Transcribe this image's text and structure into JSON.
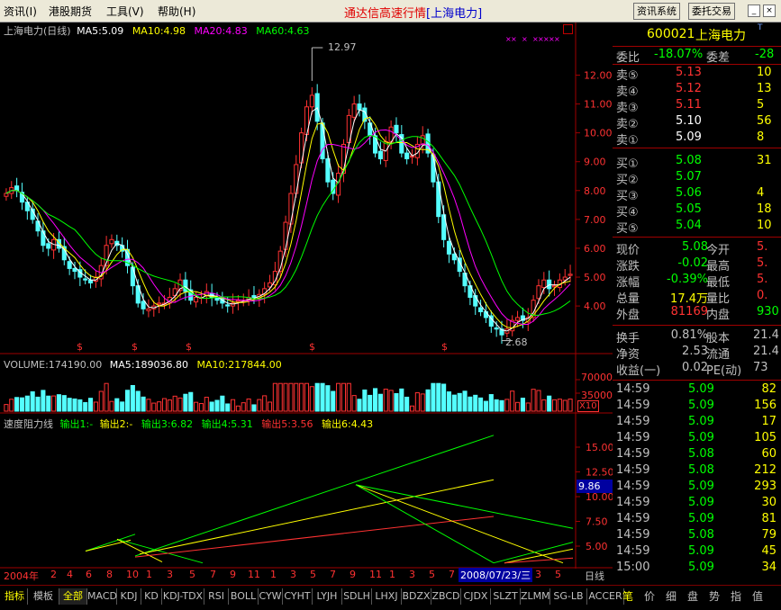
{
  "menu": [
    "资讯(I)",
    "港股期货",
    "工具(V)",
    "帮助(H)"
  ],
  "title": {
    "prefix": "通达信高速行情",
    "stock": "[上海电力]"
  },
  "top_buttons": [
    "资讯系统",
    "委托交易"
  ],
  "main_legend": {
    "title": "上海电力(日线)",
    "ma5": "MA5:5.09",
    "ma10": "MA10:4.98",
    "ma20": "MA20:4.83",
    "ma60": "MA60:4.63"
  },
  "annotations": {
    "high": "12.97",
    "low": "2.68"
  },
  "volume_legend": {
    "label": "VOLUME:174190.00",
    "ma5": "MA5:189036.80",
    "ma10": "MA10:217844.00"
  },
  "volume_axis": {
    "top": "70000",
    "mid": "35000",
    "unit": "X10"
  },
  "indicator_legend": {
    "name": "速度阻力线",
    "out1": "输出1:-",
    "out2": "输出2:-",
    "out3": "输出3:6.82",
    "out4": "输出4:5.31",
    "out5": "输出5:3.56",
    "out6": "输出6:4.43"
  },
  "indicator_axis": [
    "15.00",
    "12.50",
    "10.00",
    "7.50",
    "5.00"
  ],
  "cursor_value": "9.86",
  "price_axis": [
    "12.00",
    "11.00",
    "10.00",
    "9.00",
    "8.00",
    "7.00",
    "6.00",
    "5.00",
    "4.00"
  ],
  "date_axis": {
    "start": "2004年",
    "labels": [
      "2",
      "4",
      "6",
      "8",
      "10",
      "1",
      "3",
      "5",
      "7",
      "9",
      "11",
      "1",
      "3",
      "5",
      "7",
      "9",
      "11",
      "1",
      "3",
      "5",
      "7"
    ],
    "cursor_date": "2008/07/23/三",
    "after": [
      "3",
      "5"
    ],
    "period": "日线"
  },
  "colors": {
    "up": "#ff3232",
    "down": "#54ffff",
    "ma5": "#ffffff",
    "ma10": "#ffff00",
    "ma20": "#ff00ff",
    "ma60": "#00ff00"
  },
  "quote": {
    "code": "600021",
    "name": "上海电力",
    "wb_label": "委比",
    "wb_value": "-18.07%",
    "wc_label": "委差",
    "wc_value": "-28",
    "asks": [
      {
        "label": "卖⑤",
        "price": "5.13",
        "vol": "10"
      },
      {
        "label": "卖④",
        "price": "5.12",
        "vol": "13"
      },
      {
        "label": "卖③",
        "price": "5.11",
        "vol": "5"
      },
      {
        "label": "卖②",
        "price": "5.10",
        "vol": "56"
      },
      {
        "label": "卖①",
        "price": "5.09",
        "vol": "8"
      }
    ],
    "bids": [
      {
        "label": "买①",
        "price": "5.08",
        "vol": "31"
      },
      {
        "label": "买②",
        "price": "5.07",
        "vol": ""
      },
      {
        "label": "买③",
        "price": "5.06",
        "vol": "4"
      },
      {
        "label": "买④",
        "price": "5.05",
        "vol": "18"
      },
      {
        "label": "买⑤",
        "price": "5.04",
        "vol": "10"
      }
    ],
    "stats": [
      {
        "l1": "现价",
        "v1": "5.08",
        "l2": "今开",
        "v2": "5."
      },
      {
        "l1": "涨跌",
        "v1": "-0.02",
        "l2": "最高",
        "v2": "5."
      },
      {
        "l1": "涨幅",
        "v1": "-0.39%",
        "l2": "最低",
        "v2": "5."
      },
      {
        "l1": "总量",
        "v1": "17.4万",
        "l2": "量比",
        "v2": "0."
      },
      {
        "l1": "外盘",
        "v1": "81169",
        "l2": "内盘",
        "v2": "930"
      }
    ],
    "stats2": [
      {
        "l1": "换手",
        "v1": "0.81%",
        "l2": "股本",
        "v2": "21.4"
      },
      {
        "l1": "净资",
        "v1": "2.53",
        "l2": "流通",
        "v2": "21.4"
      },
      {
        "l1": "收益(一)",
        "v1": "0.02",
        "l2": "PE(动)",
        "v2": "73"
      }
    ],
    "ticks": [
      {
        "time": "14:59",
        "price": "5.09",
        "vol": "82"
      },
      {
        "time": "14:59",
        "price": "5.09",
        "vol": "156"
      },
      {
        "time": "14:59",
        "price": "5.09",
        "vol": "17"
      },
      {
        "time": "14:59",
        "price": "5.09",
        "vol": "105"
      },
      {
        "time": "14:59",
        "price": "5.08",
        "vol": "60"
      },
      {
        "time": "14:59",
        "price": "5.08",
        "vol": "212"
      },
      {
        "time": "14:59",
        "price": "5.09",
        "vol": "293"
      },
      {
        "time": "14:59",
        "price": "5.09",
        "vol": "30"
      },
      {
        "time": "14:59",
        "price": "5.09",
        "vol": "81"
      },
      {
        "time": "14:59",
        "price": "5.08",
        "vol": "79"
      },
      {
        "time": "14:59",
        "price": "5.09",
        "vol": "45"
      },
      {
        "time": "15:00",
        "price": "5.09",
        "vol": "34"
      }
    ]
  },
  "bottom_tabs": [
    "指标",
    "模板",
    "全部",
    "MACD",
    "KDJ",
    "KD",
    "KDJ-TDX",
    "RSI",
    "BOLL",
    "CYW",
    "CYHT",
    "LYJH",
    "SDLH",
    "LHXJ",
    "BDZX",
    "ZBCD",
    "CJDX",
    "SLZT",
    "ZLMM",
    "SG-LB",
    "ACCER"
  ],
  "right_tabs": [
    "笔",
    "价",
    "细",
    "盘",
    "势",
    "指",
    "值"
  ],
  "chart_data": {
    "type": "candlestick",
    "price_range": [
      2.6,
      13.2
    ],
    "closes": [
      7.9,
      8.1,
      8.0,
      7.6,
      7.3,
      7.0,
      6.6,
      6.1,
      6.0,
      6.3,
      6.0,
      5.6,
      5.3,
      5.2,
      5.0,
      4.9,
      4.8,
      5.0,
      5.4,
      6.1,
      6.3,
      6.1,
      5.9,
      5.4,
      4.7,
      4.1,
      3.9,
      3.9,
      4.0,
      4.1,
      4.1,
      4.3,
      4.6,
      4.9,
      4.5,
      4.2,
      4.3,
      4.3,
      4.5,
      4.3,
      4.2,
      4.1,
      4.0,
      4.1,
      4.2,
      4.2,
      4.3,
      4.3,
      4.4,
      4.6,
      4.8,
      5.2,
      5.9,
      6.9,
      7.9,
      8.9,
      10.0,
      10.9,
      11.3,
      10.4,
      9.1,
      8.3,
      7.9,
      8.6,
      9.6,
      10.6,
      11.0,
      10.8,
      10.4,
      9.9,
      9.3,
      9.1,
      9.7,
      10.2,
      10.0,
      9.3,
      9.1,
      9.2,
      9.6,
      9.9,
      9.3,
      8.3,
      7.1,
      6.3,
      5.8,
      5.6,
      5.2,
      4.7,
      4.3,
      4.0,
      3.8,
      3.6,
      3.3,
      3.2,
      3.0,
      3.2,
      3.5,
      3.6,
      3.5,
      3.6,
      4.2,
      4.7,
      4.9,
      4.6,
      4.7,
      4.9,
      5.0,
      5.1
    ]
  }
}
